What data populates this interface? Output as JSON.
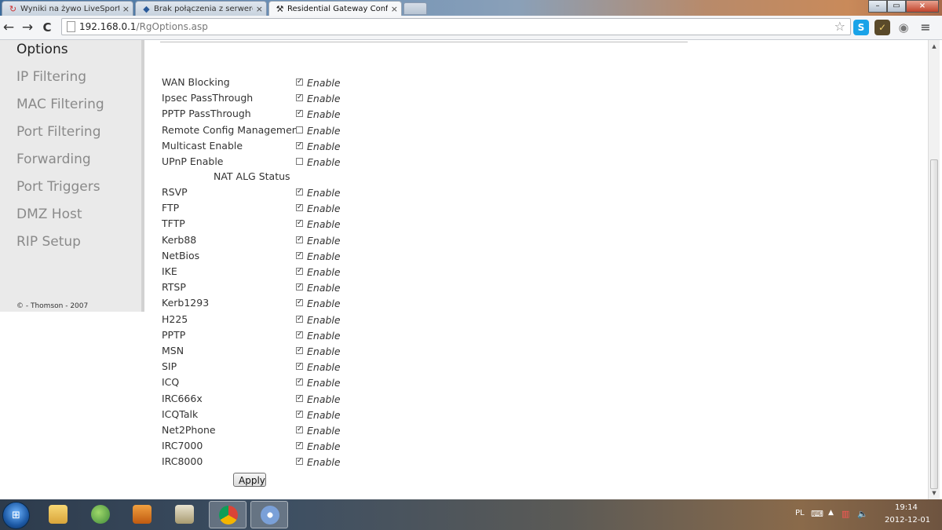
{
  "browser": {
    "tabs": [
      {
        "label": "Wyniki na żywo LiveSports",
        "icon": "refresh-icon",
        "active": false
      },
      {
        "label": "Brak połączenia z serwerem",
        "icon": "shield-icon",
        "active": false
      },
      {
        "label": "Residential Gateway Confi",
        "icon": "tools-icon",
        "active": true
      }
    ],
    "tab_close": "×",
    "back": "←",
    "forward": "→",
    "reload": "C",
    "url_host": "192.168.0.1",
    "url_path": "/RgOptions.asp",
    "star": "☆",
    "extensions": [
      "skype-icon",
      "extension-icon",
      "eye-icon"
    ],
    "menu": "≡",
    "window_controls": {
      "minimize": "–",
      "maximize": "▭",
      "close": "×"
    }
  },
  "sidebar": {
    "title": "Options",
    "items": [
      "IP Filtering",
      "MAC Filtering",
      "Port Filtering",
      "Forwarding",
      "Port Triggers",
      "DMZ Host",
      "RIP Setup"
    ],
    "copyright": "© - Thomson - 2007"
  },
  "options": {
    "enable_label": "Enable",
    "rows": [
      {
        "label": "WAN Blocking",
        "checked": true
      },
      {
        "label": "Ipsec PassThrough",
        "checked": true
      },
      {
        "label": "PPTP PassThrough",
        "checked": true
      },
      {
        "label": "Remote Config Management",
        "checked": false
      },
      {
        "label": "Multicast Enable",
        "checked": true
      },
      {
        "label": "UPnP Enable",
        "checked": false
      }
    ],
    "nat_title": "NAT ALG Status",
    "nat_rows": [
      {
        "label": "RSVP",
        "checked": true
      },
      {
        "label": "FTP",
        "checked": true
      },
      {
        "label": "TFTP",
        "checked": true
      },
      {
        "label": "Kerb88",
        "checked": true
      },
      {
        "label": "NetBios",
        "checked": true
      },
      {
        "label": "IKE",
        "checked": true
      },
      {
        "label": "RTSP",
        "checked": true
      },
      {
        "label": "Kerb1293",
        "checked": true
      },
      {
        "label": "H225",
        "checked": true
      },
      {
        "label": "PPTP",
        "checked": true
      },
      {
        "label": "MSN",
        "checked": true
      },
      {
        "label": "SIP",
        "checked": true
      },
      {
        "label": "ICQ",
        "checked": true
      },
      {
        "label": "IRC666x",
        "checked": true
      },
      {
        "label": "ICQTalk",
        "checked": true
      },
      {
        "label": "Net2Phone",
        "checked": true
      },
      {
        "label": "IRC7000",
        "checked": true
      },
      {
        "label": "IRC8000",
        "checked": true
      }
    ],
    "apply_label": "Apply"
  },
  "taskbar": {
    "apps": [
      "explorer-icon",
      "people-icon",
      "media-player-icon",
      "clipboard-icon",
      "chrome-icon",
      "paint-icon"
    ],
    "active_app": "chrome-icon",
    "tray": {
      "language": "PL",
      "time": "19:14",
      "date": "2012-12-01"
    }
  }
}
